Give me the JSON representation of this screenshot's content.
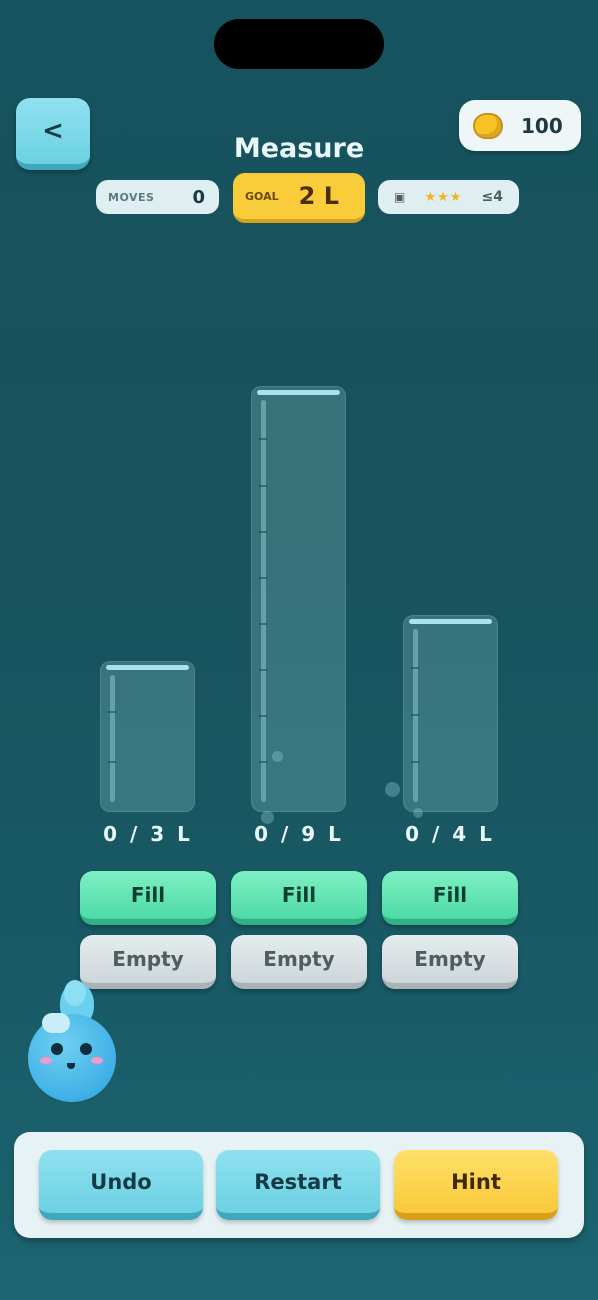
{
  "header": {
    "back_label": "<",
    "title": "Measure",
    "coins": "100"
  },
  "stats": {
    "moves_label": "MOVES",
    "moves_value": "0",
    "goal_label": "GOAL",
    "goal_value": "2 L",
    "stars": "★★★",
    "move_limit": "≤4"
  },
  "jugs": [
    {
      "label": "0 / 3 L",
      "current": 0,
      "capacity": 3,
      "fill_label": "Fill",
      "empty_label": "Empty"
    },
    {
      "label": "0 / 9 L",
      "current": 0,
      "capacity": 9,
      "fill_label": "Fill",
      "empty_label": "Empty"
    },
    {
      "label": "0 / 4 L",
      "current": 0,
      "capacity": 4,
      "fill_label": "Fill",
      "empty_label": "Empty"
    }
  ],
  "controls": {
    "undo": "Undo",
    "restart": "Restart",
    "hint": "Hint"
  },
  "colors": {
    "accent_blue": "#6cd1e3",
    "fill_green": "#4fd9a7",
    "goal_yellow": "#f9cd3a"
  },
  "icons": {
    "back": "chevron-left-icon",
    "coin": "coin-icon",
    "star": "star-icon",
    "mascot": "water-drop-mascot"
  }
}
